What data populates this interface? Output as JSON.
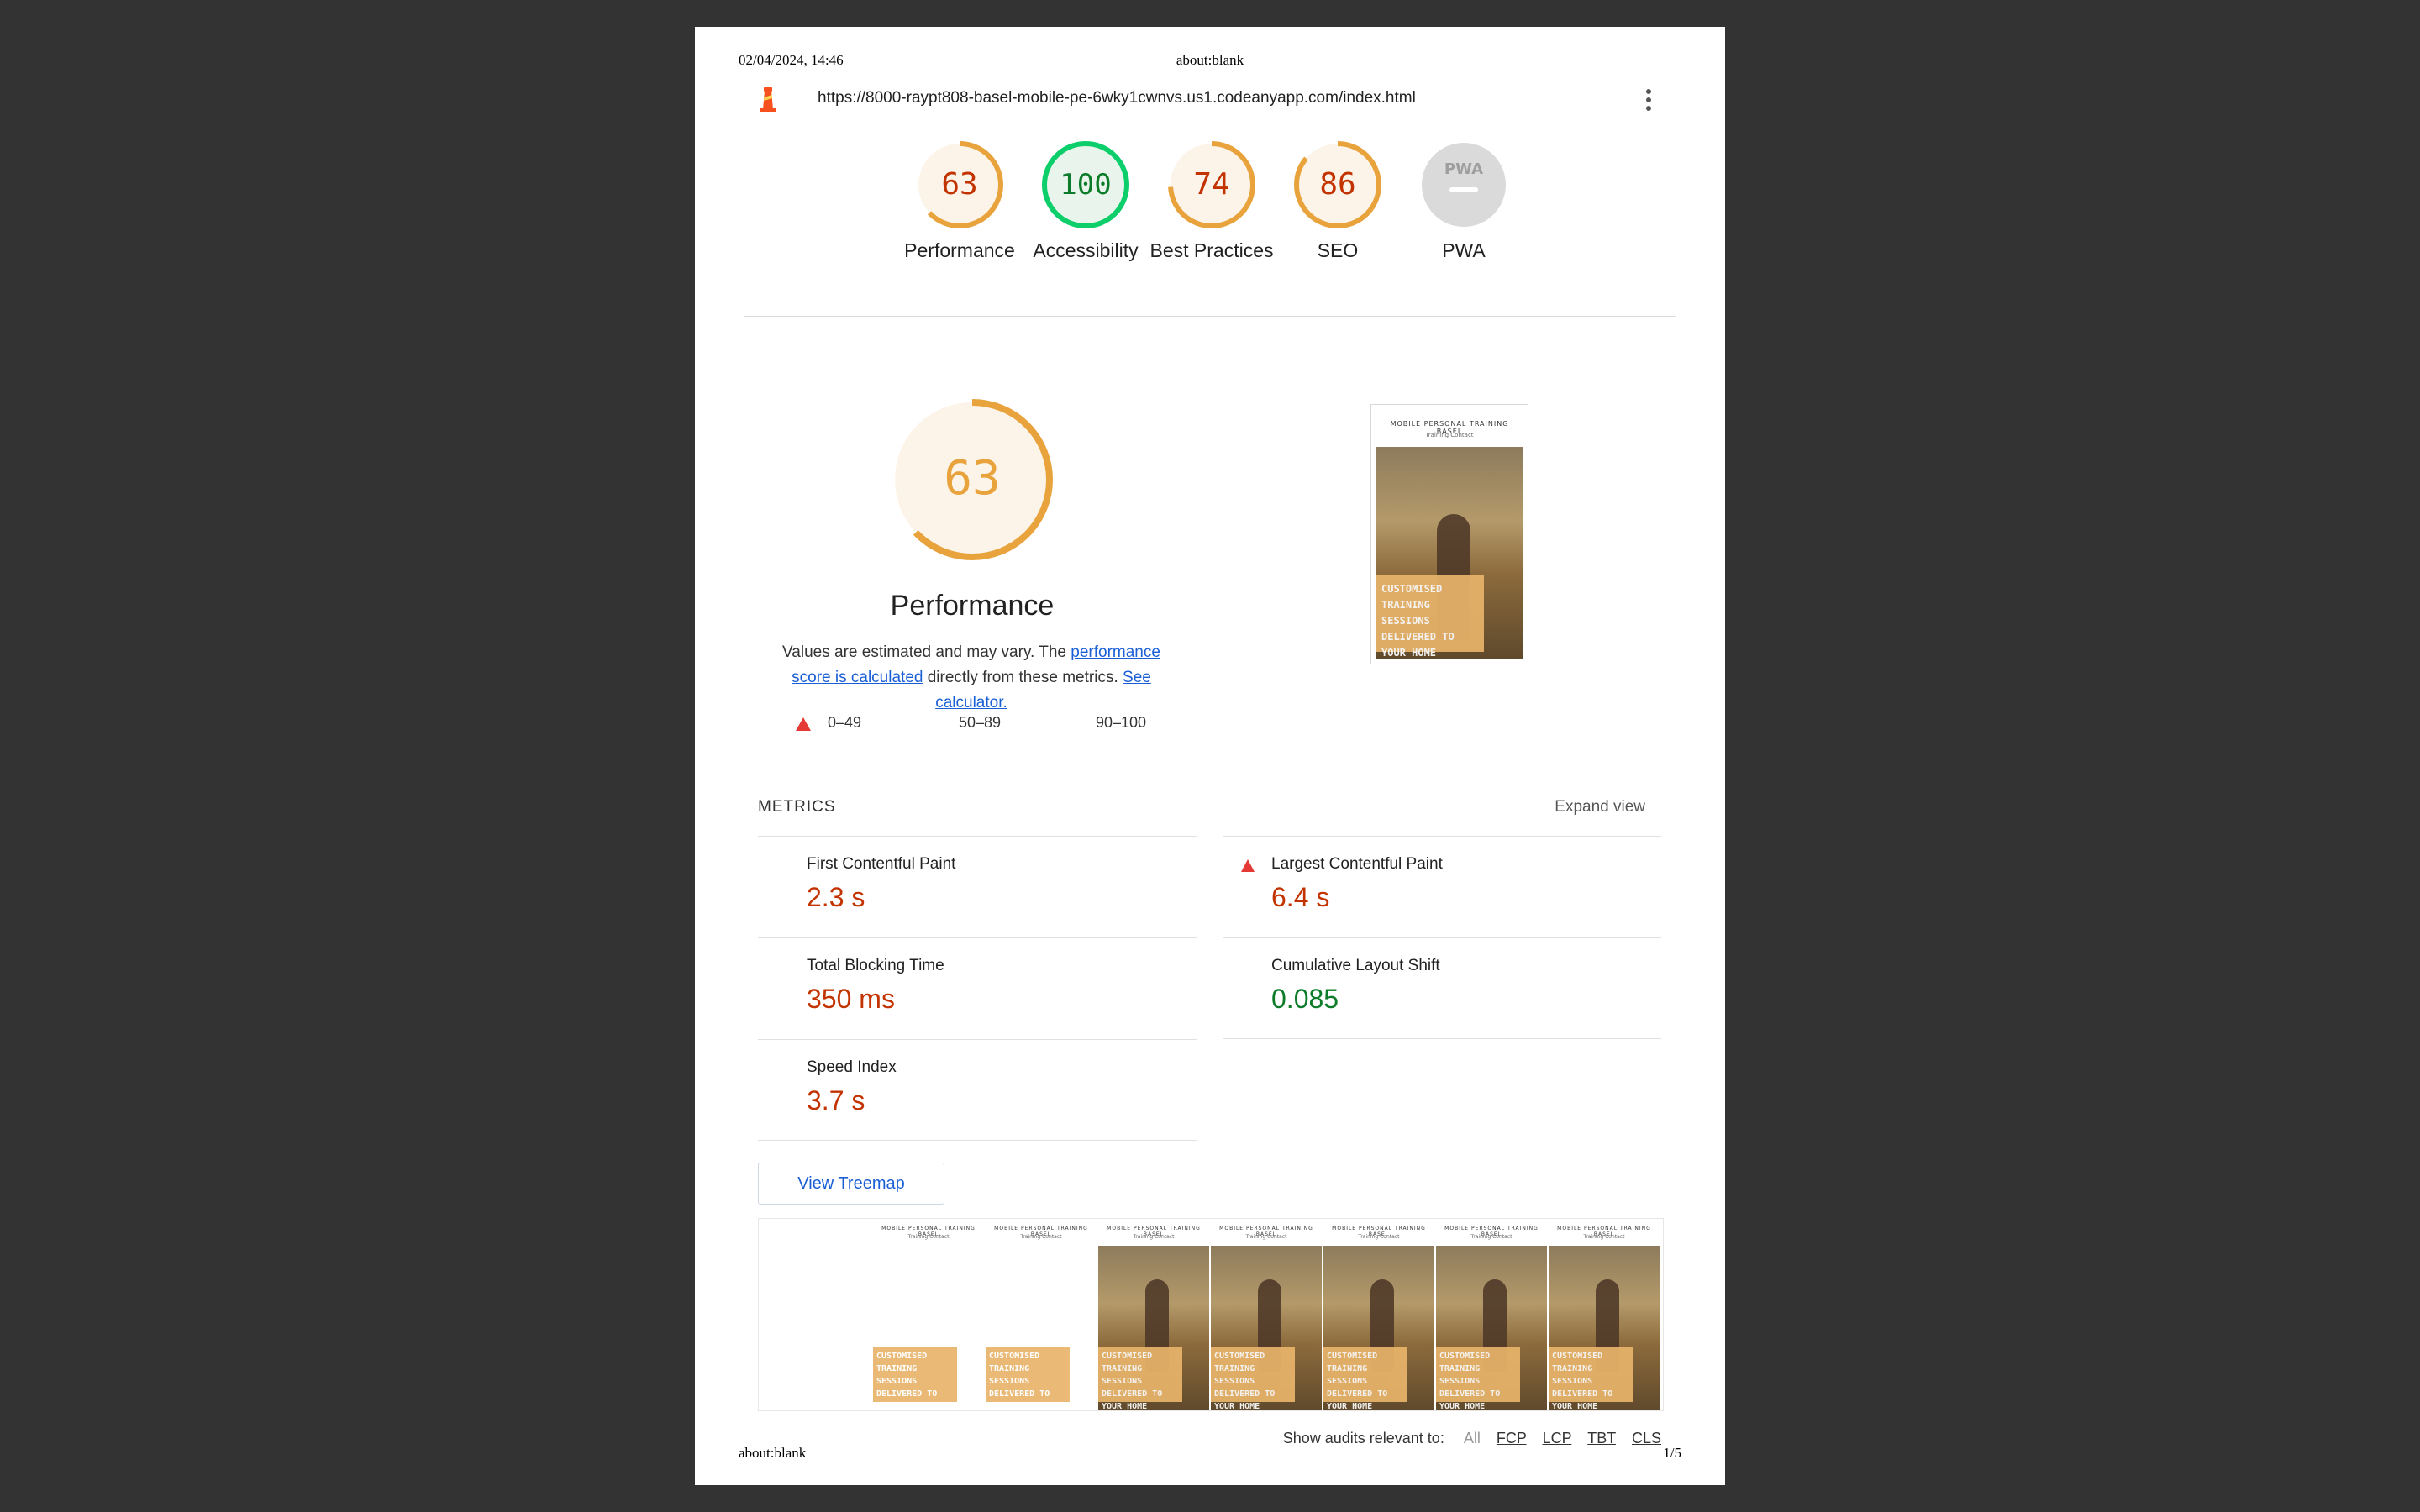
{
  "print_header": {
    "date": "02/04/2024, 14:46",
    "title": "about:blank"
  },
  "print_footer": {
    "left": "about:blank",
    "page": "1/5"
  },
  "topbar": {
    "url": "https://8000-raypt808-basel-mobile-pe-6wky1cwnvs.us1.codeanyapp.com/index.html"
  },
  "gauges": [
    {
      "score": "63",
      "label": "Performance",
      "value": 0.63,
      "status": "average"
    },
    {
      "score": "100",
      "label": "Accessibility",
      "value": 1.0,
      "status": "pass"
    },
    {
      "score": "74",
      "label": "Best Practices",
      "value": 0.74,
      "status": "average"
    },
    {
      "score": "86",
      "label": "SEO",
      "value": 0.86,
      "status": "average"
    },
    {
      "score": "",
      "label": "PWA",
      "value": null,
      "status": "na",
      "badge": "PWA"
    }
  ],
  "performance": {
    "score": "63",
    "value": 0.63,
    "title": "Performance",
    "desc_prefix": "Values are estimated and may vary. The ",
    "link_score": "performance score is calculated",
    "desc_middle": " directly from these metrics. ",
    "link_calc": "See calculator.",
    "legend": {
      "fail": "0–49",
      "average": "50–89",
      "pass": "90–100"
    }
  },
  "screenshot": {
    "heading": "MOBILE PERSONAL TRAINING BASEL",
    "nav": "Training   Contact",
    "banner": "CUSTOMISED TRAINING SESSIONS DELIVERED TO YOUR HOME"
  },
  "metrics": {
    "header": "METRICS",
    "expand": "Expand view",
    "items": [
      {
        "label": "First Contentful Paint",
        "value": "2.3 s",
        "status": "average"
      },
      {
        "label": "Largest Contentful Paint",
        "value": "6.4 s",
        "status": "fail"
      },
      {
        "label": "Total Blocking Time",
        "value": "350 ms",
        "status": "average"
      },
      {
        "label": "Cumulative Layout Shift",
        "value": "0.085",
        "status": "pass"
      },
      {
        "label": "Speed Index",
        "value": "3.7 s",
        "status": "average"
      }
    ]
  },
  "treemap": {
    "label": "View Treemap"
  },
  "audits": {
    "label": "Show audits relevant to:",
    "all": "All",
    "filters": [
      "FCP",
      "LCP",
      "TBT",
      "CLS"
    ]
  },
  "colors": {
    "average": "#e8a33d",
    "pass": "#0c7c2a",
    "fail": "#e53935",
    "average_text": "#c33300"
  }
}
